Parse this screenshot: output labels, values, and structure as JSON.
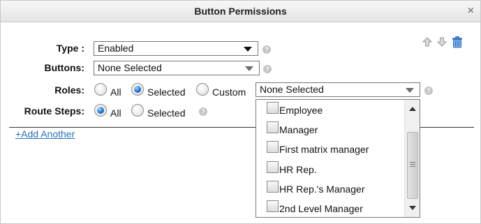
{
  "dialog": {
    "title": "Button Permissions",
    "close_label": "×"
  },
  "form": {
    "type": {
      "label": "Type :",
      "value": "Enabled"
    },
    "buttons": {
      "label": "Buttons:",
      "value": "None Selected"
    },
    "roles": {
      "label": "Roles:",
      "options": [
        "All",
        "Selected",
        "Custom"
      ],
      "selected": "Selected",
      "custom_value": "None Selected"
    },
    "route_steps": {
      "label": "Route Steps:",
      "options": [
        "All",
        "Selected"
      ],
      "selected": "All"
    }
  },
  "add_another": "+Add Another",
  "help_glyph": "?",
  "roles_list": {
    "items": [
      "Employee",
      "Manager",
      "First matrix manager",
      "HR Rep.",
      "HR Rep.'s Manager",
      "2nd Level Manager"
    ],
    "checked": [
      false,
      false,
      false,
      false,
      false,
      false
    ],
    "scroll_position": 0.35
  },
  "icons": [
    "move-up-icon",
    "move-down-icon",
    "trash-icon",
    "help-icon",
    "close-icon"
  ],
  "colors": {
    "link": "#2a6fb8",
    "radio_selected": "#1f78d0",
    "trash": "#3a7fd0"
  }
}
